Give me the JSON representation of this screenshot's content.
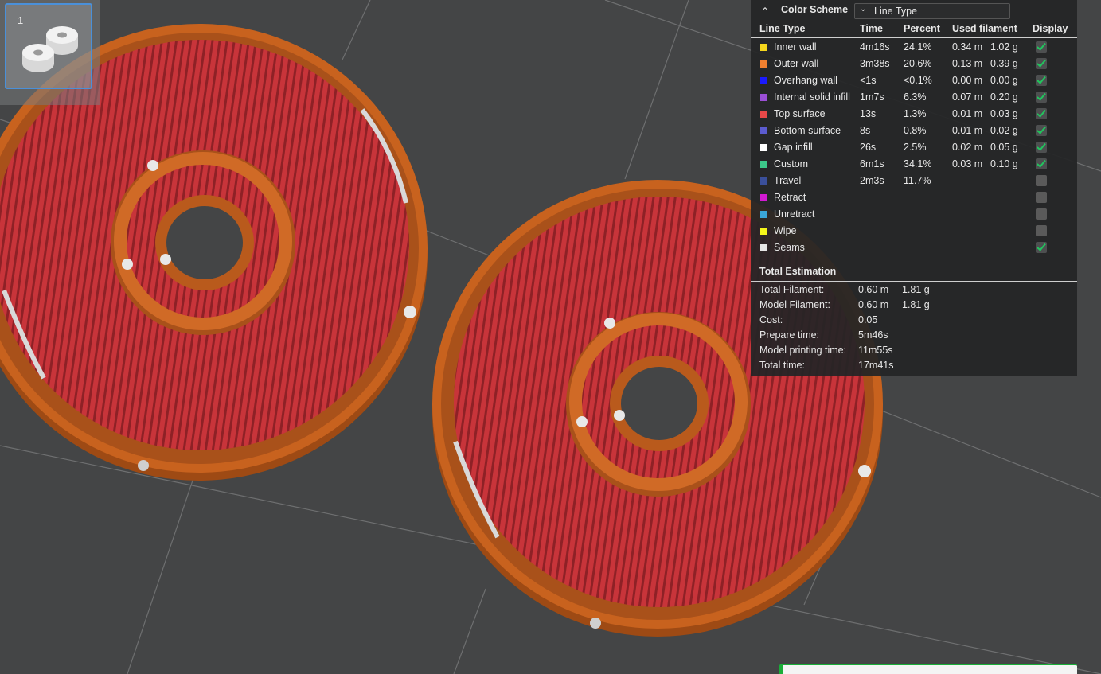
{
  "plate": {
    "number": "1"
  },
  "color_scheme": {
    "title": "Color Scheme",
    "selected": "Line Type",
    "columns": [
      "Line Type",
      "Time",
      "Percent",
      "Used filament",
      "Display"
    ],
    "rows": [
      {
        "name": "Inner wall",
        "color": "#f5d61c",
        "time": "4m16s",
        "percent": "24.1%",
        "length": "0.34 m",
        "weight": "1.02 g",
        "display": true
      },
      {
        "name": "Outer wall",
        "color": "#f08030",
        "time": "3m38s",
        "percent": "20.6%",
        "length": "0.13 m",
        "weight": "0.39 g",
        "display": true
      },
      {
        "name": "Overhang wall",
        "color": "#1a1aff",
        "time": "<1s",
        "percent": "<0.1%",
        "length": "0.00 m",
        "weight": "0.00 g",
        "display": true
      },
      {
        "name": "Internal solid infill",
        "color": "#9b4fd6",
        "time": "1m7s",
        "percent": "6.3%",
        "length": "0.07 m",
        "weight": "0.20 g",
        "display": true
      },
      {
        "name": "Top surface",
        "color": "#e84848",
        "time": "13s",
        "percent": "1.3%",
        "length": "0.01 m",
        "weight": "0.03 g",
        "display": true
      },
      {
        "name": "Bottom surface",
        "color": "#5b5bcf",
        "time": "8s",
        "percent": "0.8%",
        "length": "0.01 m",
        "weight": "0.02 g",
        "display": true
      },
      {
        "name": "Gap infill",
        "color": "#ffffff",
        "time": "26s",
        "percent": "2.5%",
        "length": "0.02 m",
        "weight": "0.05 g",
        "display": true
      },
      {
        "name": "Custom",
        "color": "#3cc88a",
        "time": "6m1s",
        "percent": "34.1%",
        "length": "0.03 m",
        "weight": "0.10 g",
        "display": true
      },
      {
        "name": "Travel",
        "color": "#3a4f9a",
        "time": "2m3s",
        "percent": "11.7%",
        "length": "",
        "weight": "",
        "display": false
      },
      {
        "name": "Retract",
        "color": "#d21ad2",
        "time": "",
        "percent": "",
        "length": "",
        "weight": "",
        "display": false
      },
      {
        "name": "Unretract",
        "color": "#3aa6d8",
        "time": "",
        "percent": "",
        "length": "",
        "weight": "",
        "display": false
      },
      {
        "name": "Wipe",
        "color": "#f5f51a",
        "time": "",
        "percent": "",
        "length": "",
        "weight": "",
        "display": false
      },
      {
        "name": "Seams",
        "color": "#e6e6e6",
        "time": "",
        "percent": "",
        "length": "",
        "weight": "",
        "display": true
      }
    ]
  },
  "total_estimation": {
    "title": "Total Estimation",
    "rows": [
      {
        "label": "Total Filament:",
        "value": "0.60 m",
        "value2": "1.81 g"
      },
      {
        "label": "Model Filament:",
        "value": "0.60 m",
        "value2": "1.81 g"
      },
      {
        "label": "Cost:",
        "value": "0.05",
        "value2": ""
      },
      {
        "label": "Prepare time:",
        "value": "5m46s",
        "value2": ""
      },
      {
        "label": "Model printing time:",
        "value": "11m55s",
        "value2": ""
      },
      {
        "label": "Total time:",
        "value": "17m41s",
        "value2": ""
      }
    ]
  }
}
